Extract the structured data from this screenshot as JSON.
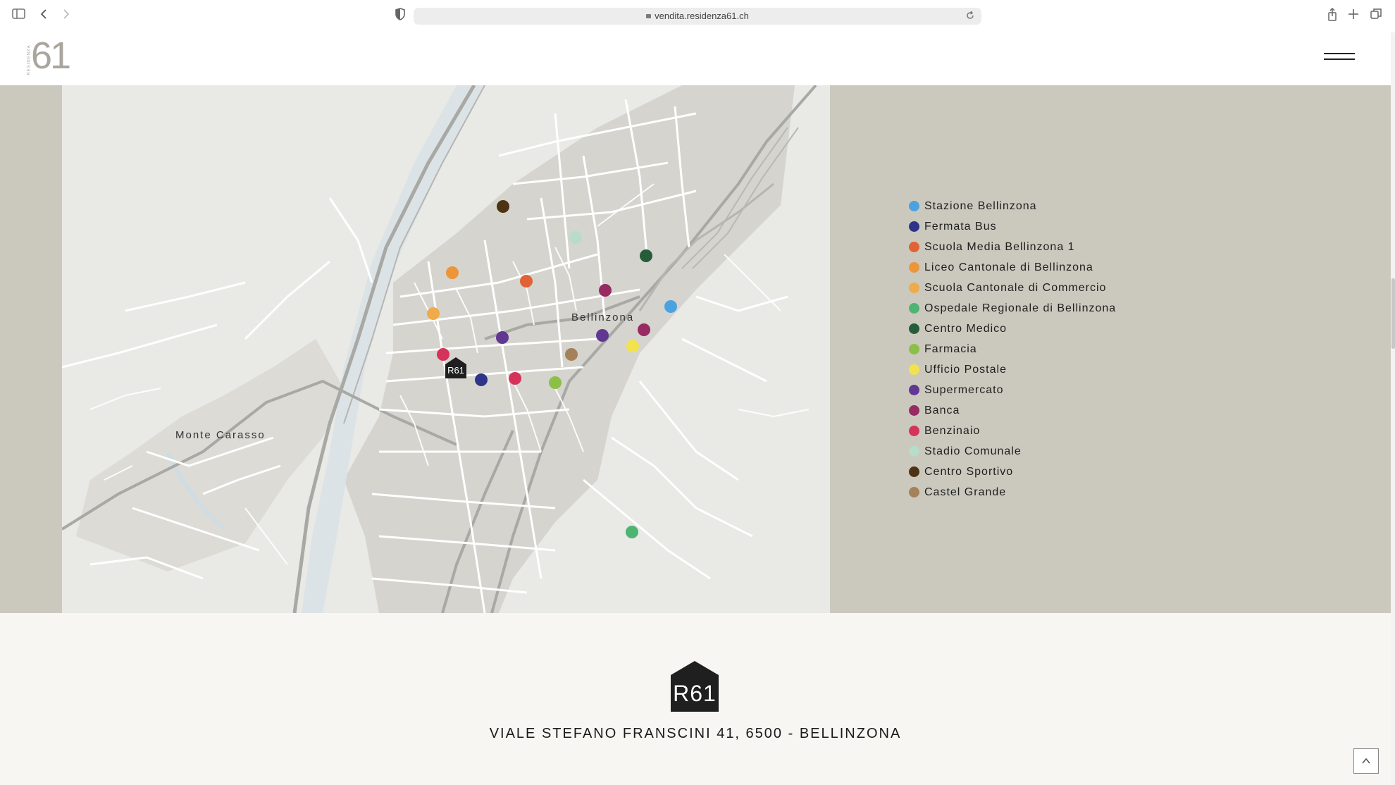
{
  "browser": {
    "url": "vendita.residenza61.ch",
    "icons": [
      "sidebar-icon",
      "back-icon",
      "forward-icon",
      "shield-icon",
      "reload-icon",
      "share-icon",
      "new-tab-icon",
      "tabs-overview-icon"
    ]
  },
  "header": {
    "logo_number": "61",
    "logo_side_text": "RESIDENZA",
    "menu_icon": "hamburger-menu-icon"
  },
  "map": {
    "place_labels": {
      "bellinzona": "Bellinzona",
      "monte_carasso": "Monte Carasso"
    },
    "marker_label": "R61",
    "markers": [
      {
        "category": "Stazione Bellinzona",
        "color": "#4aa3e0"
      },
      {
        "category": "Fermata Bus",
        "color": "#2e3588"
      },
      {
        "category": "Scuola Media Bellinzona 1",
        "color": "#e06236"
      },
      {
        "category": "Liceo Cantonale di Bellinzona",
        "color": "#ec9539"
      },
      {
        "category": "Scuola Cantonale di Commercio",
        "color": "#efaa49"
      },
      {
        "category": "Ospedale Regionale di Bellinzona",
        "color": "#4db472"
      },
      {
        "category": "Centro Medico",
        "color": "#255c3a"
      },
      {
        "category": "Farmacia",
        "color": "#8cbf48"
      },
      {
        "category": "Ufficio Postale",
        "color": "#f2e34c"
      },
      {
        "category": "Supermercato",
        "color": "#613794"
      },
      {
        "category": "Banca",
        "color": "#982b63"
      },
      {
        "category": "Benzinaio",
        "color": "#d6335b"
      },
      {
        "category": "Stadio Comunale",
        "color": "#b7dcc9"
      },
      {
        "category": "Centro Sportivo",
        "color": "#4e3214"
      },
      {
        "category": "Castel Grande",
        "color": "#a5815a"
      }
    ]
  },
  "legend": [
    {
      "label": "Stazione Bellinzona",
      "color": "#4aa3e0"
    },
    {
      "label": "Fermata Bus",
      "color": "#2e3588"
    },
    {
      "label": "Scuola Media Bellinzona 1",
      "color": "#e06236"
    },
    {
      "label": "Liceo Cantonale di Bellinzona",
      "color": "#ec9539"
    },
    {
      "label": "Scuola Cantonale di Commercio",
      "color": "#efaa49"
    },
    {
      "label": "Ospedale Regionale di Bellinzona",
      "color": "#4db472"
    },
    {
      "label": "Centro Medico",
      "color": "#255c3a"
    },
    {
      "label": "Farmacia",
      "color": "#8cbf48"
    },
    {
      "label": "Ufficio Postale",
      "color": "#f2e34c"
    },
    {
      "label": "Supermercato",
      "color": "#613794"
    },
    {
      "label": "Banca",
      "color": "#982b63"
    },
    {
      "label": "Benzinaio",
      "color": "#d6335b"
    },
    {
      "label": "Stadio Comunale",
      "color": "#b7dcc9"
    },
    {
      "label": "Centro Sportivo",
      "color": "#4e3214"
    },
    {
      "label": "Castel Grande",
      "color": "#a5815a"
    }
  ],
  "footer": {
    "logo_text": "R61",
    "address": "VIALE STEFANO FRANSCINI 41, 6500 - BELLINZONA",
    "back_to_top_icon": "chevron-up-icon"
  }
}
